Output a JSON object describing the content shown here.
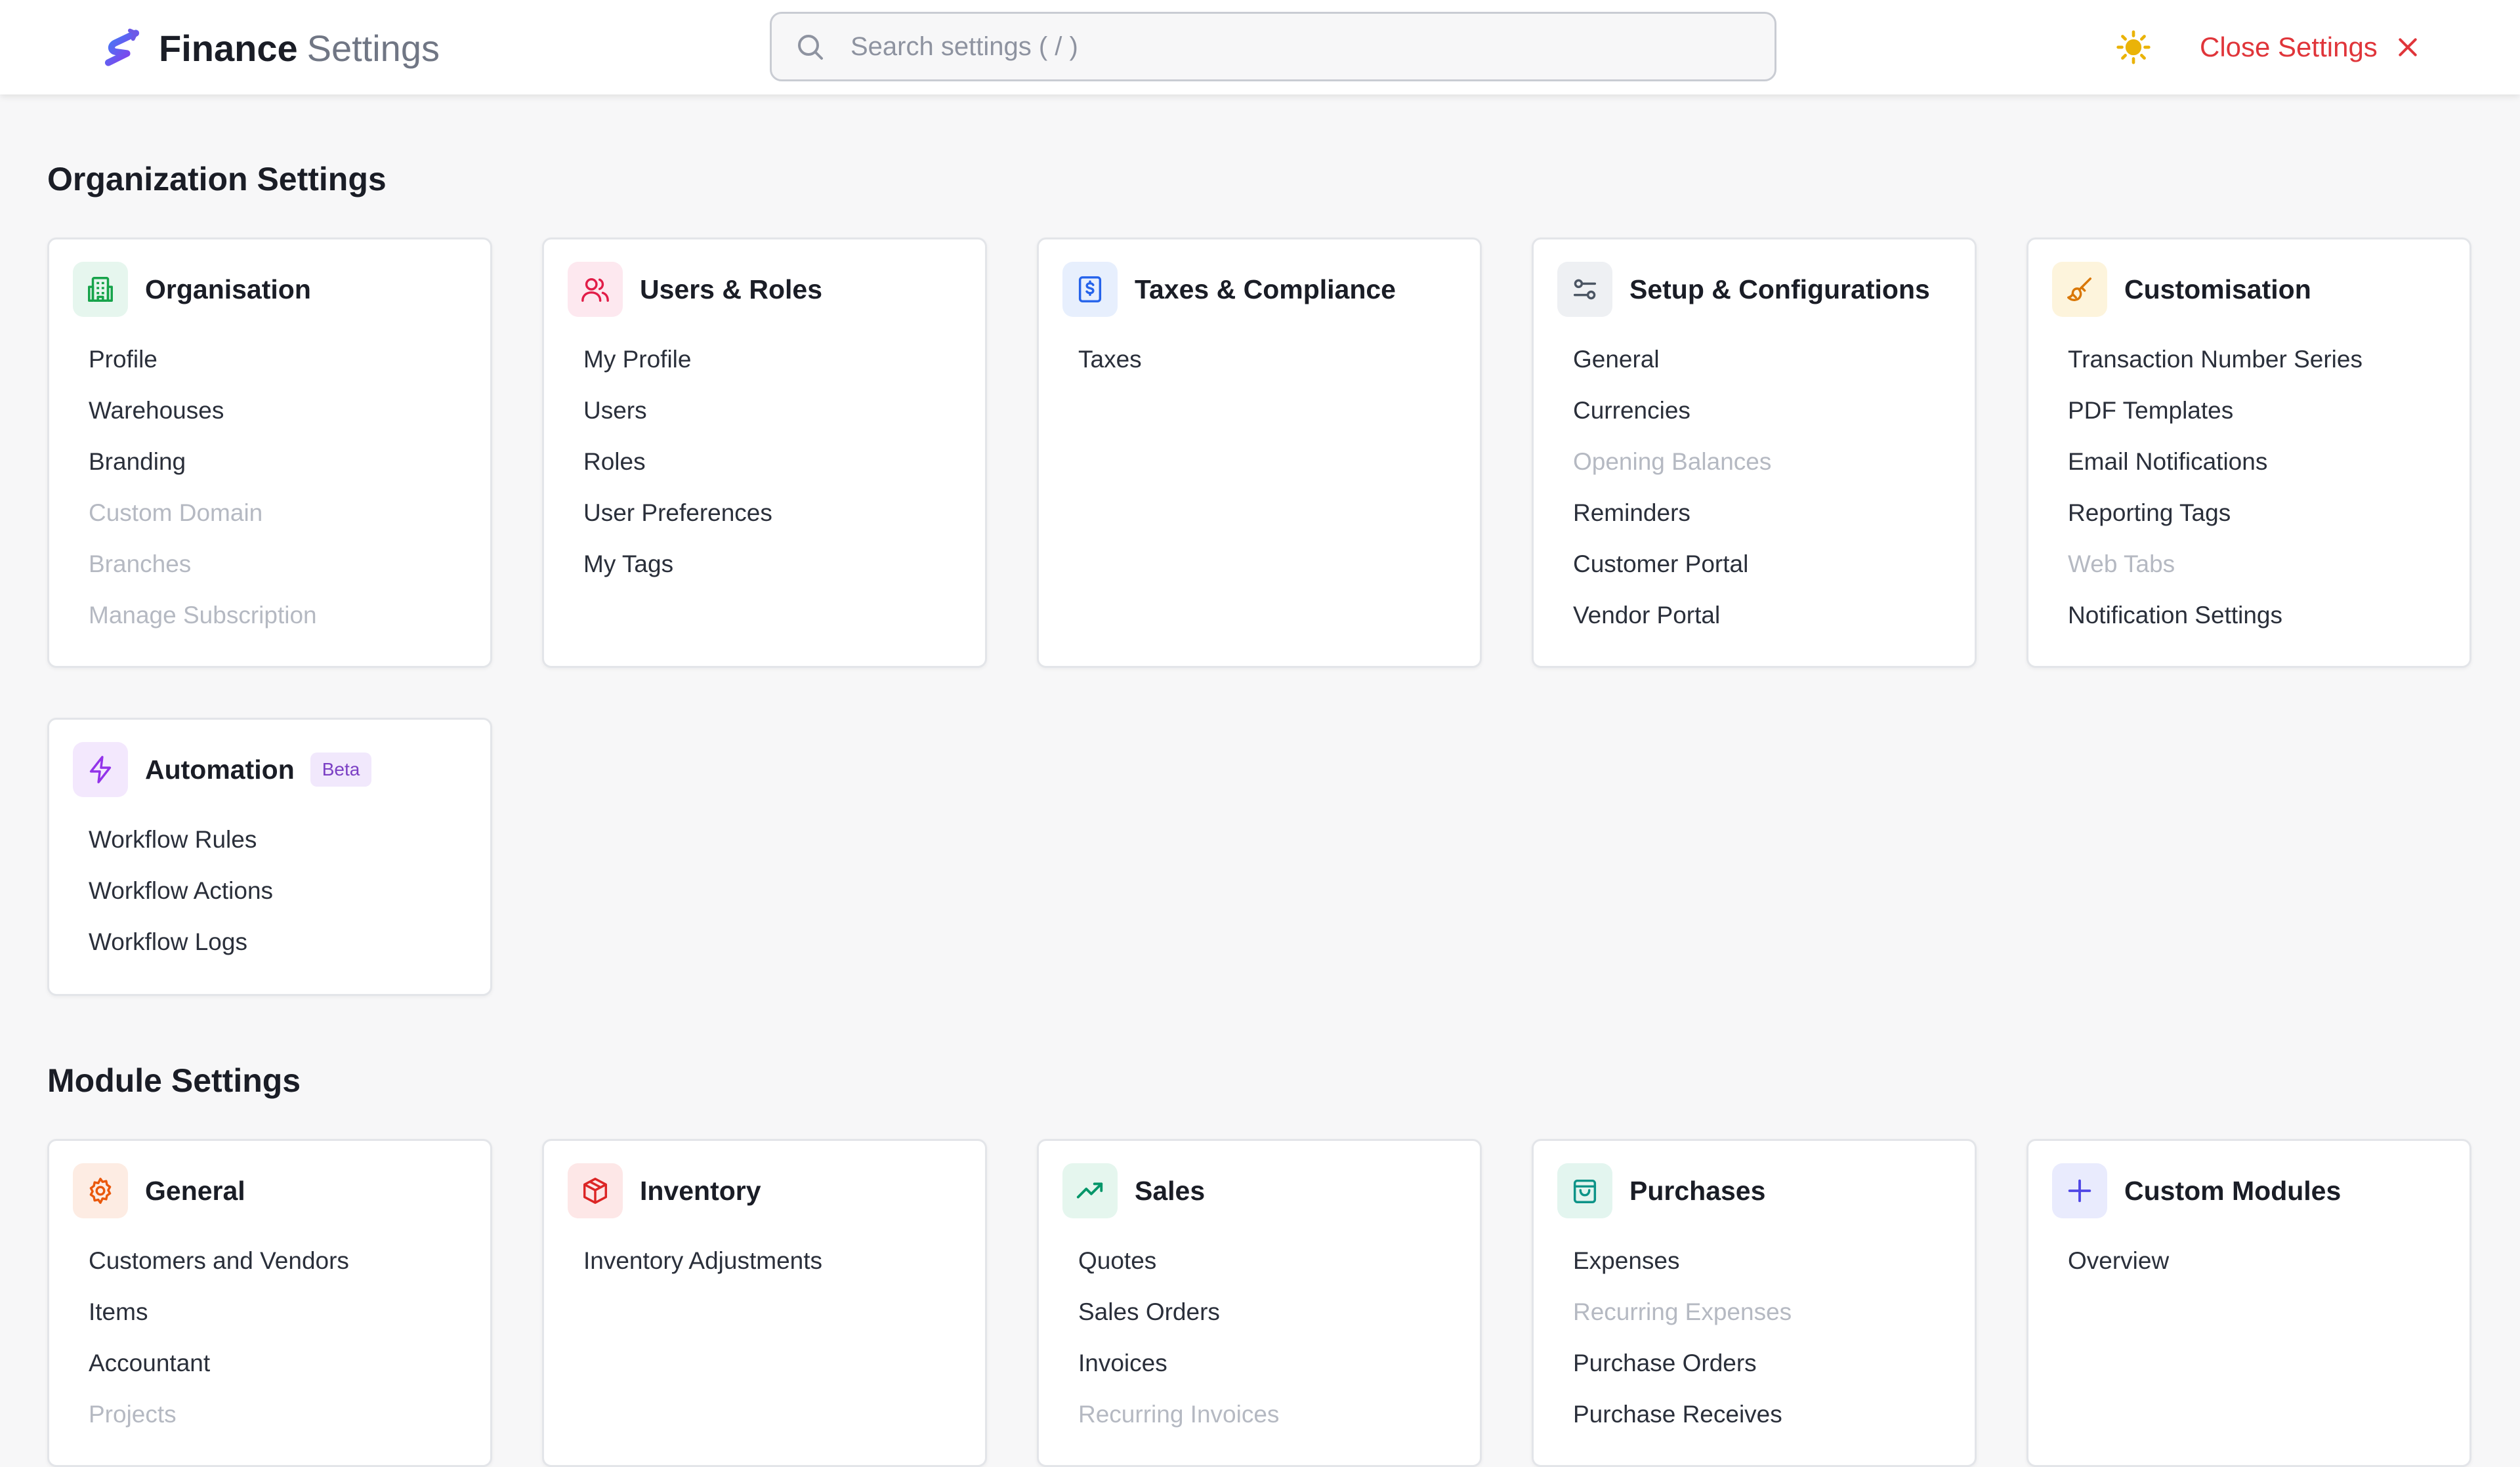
{
  "header": {
    "brand_bold": "Finance",
    "brand_light": "Settings",
    "search_placeholder": "Search settings ( / )",
    "close_label": "Close Settings"
  },
  "colors": {
    "accent_close": "#e0353a",
    "sun": "#eab308"
  },
  "org_section": {
    "title": "Organization Settings",
    "cards": [
      {
        "title": "Organisation",
        "icon": "building-icon",
        "items": [
          {
            "label": "Profile"
          },
          {
            "label": "Warehouses"
          },
          {
            "label": "Branding"
          },
          {
            "label": "Custom Domain",
            "disabled": true
          },
          {
            "label": "Branches",
            "disabled": true
          },
          {
            "label": "Manage Subscription",
            "disabled": true
          }
        ]
      },
      {
        "title": "Users & Roles",
        "icon": "users-icon",
        "items": [
          {
            "label": "My Profile"
          },
          {
            "label": "Users"
          },
          {
            "label": "Roles"
          },
          {
            "label": "User Preferences"
          },
          {
            "label": "My Tags"
          }
        ]
      },
      {
        "title": "Taxes & Compliance",
        "icon": "tax-document-icon",
        "items": [
          {
            "label": "Taxes"
          }
        ]
      },
      {
        "title": "Setup & Configurations",
        "icon": "sliders-icon",
        "items": [
          {
            "label": "General"
          },
          {
            "label": "Currencies"
          },
          {
            "label": "Opening Balances",
            "disabled": true
          },
          {
            "label": "Reminders"
          },
          {
            "label": "Customer Portal"
          },
          {
            "label": "Vendor Portal"
          }
        ]
      },
      {
        "title": "Customisation",
        "icon": "paintbrush-icon",
        "items": [
          {
            "label": "Transaction Number Series"
          },
          {
            "label": "PDF Templates"
          },
          {
            "label": "Email Notifications"
          },
          {
            "label": "Reporting Tags"
          },
          {
            "label": "Web Tabs",
            "disabled": true
          },
          {
            "label": "Notification Settings"
          }
        ]
      },
      {
        "title": "Automation",
        "icon": "lightning-icon",
        "badge": "Beta",
        "items": [
          {
            "label": "Workflow Rules"
          },
          {
            "label": "Workflow Actions"
          },
          {
            "label": "Workflow Logs"
          }
        ]
      }
    ]
  },
  "module_section": {
    "title": "Module Settings",
    "cards": [
      {
        "title": "General",
        "icon": "gear-icon",
        "items": [
          {
            "label": "Customers and Vendors"
          },
          {
            "label": "Items"
          },
          {
            "label": "Accountant"
          },
          {
            "label": "Projects",
            "disabled": true
          }
        ]
      },
      {
        "title": "Inventory",
        "icon": "box-icon",
        "items": [
          {
            "label": "Inventory Adjustments"
          }
        ]
      },
      {
        "title": "Sales",
        "icon": "trending-up-icon",
        "items": [
          {
            "label": "Quotes"
          },
          {
            "label": "Sales Orders"
          },
          {
            "label": "Invoices"
          },
          {
            "label": "Recurring Invoices",
            "disabled": true
          }
        ]
      },
      {
        "title": "Purchases",
        "icon": "shopping-bag-icon",
        "items": [
          {
            "label": "Expenses"
          },
          {
            "label": "Recurring Expenses",
            "disabled": true
          },
          {
            "label": "Purchase Orders"
          },
          {
            "label": "Purchase Receives"
          }
        ]
      },
      {
        "title": "Custom Modules",
        "icon": "plus-icon",
        "items": [
          {
            "label": "Overview"
          }
        ]
      }
    ]
  }
}
